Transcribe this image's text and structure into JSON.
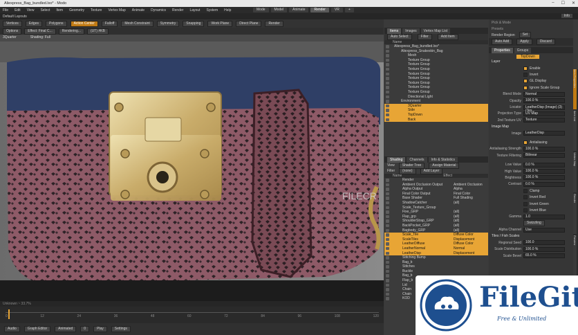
{
  "app": {
    "title": "Aliexpress_Bag_bundled.lxo* - Modo",
    "win_buttons": [
      "–",
      "☐",
      "✕"
    ]
  },
  "menu": [
    "File",
    "Edit",
    "View",
    "Select",
    "Item",
    "Geometry",
    "Texture",
    "Vertex Map",
    "Animate",
    "Dynamics",
    "Render",
    "Layout",
    "System",
    "Help"
  ],
  "modes": [
    {
      "label": "Mode",
      "on": false
    },
    {
      "label": "Model",
      "on": false
    },
    {
      "label": "Animate",
      "on": false
    },
    {
      "label": "Render",
      "on": true
    },
    {
      "label": "VR",
      "on": false
    },
    {
      "label": "+",
      "on": false
    }
  ],
  "layout_label": "Default Layouts",
  "info_label": "Info",
  "toolbar": [
    "Vertices",
    "Edges",
    "Polygons",
    "Action Center",
    "Falloff",
    "Mesh Constraint",
    "Symmetry",
    "Snapping",
    "Work Plane",
    "Direct Plane",
    "Render"
  ],
  "viewport_header": [
    "Options",
    "Effect: Final C...",
    "Rendering...",
    "(UT) #KB"
  ],
  "viewport_sub": [
    "3Quarter",
    "Shading: Full"
  ],
  "viewport_status": "Unknown  ~  33.7%",
  "transport": [
    "Audio",
    "Graph Editor",
    "Animated",
    "0",
    "Play",
    "Settings"
  ],
  "timeline_ticks": [
    "0",
    "12",
    "24",
    "36",
    "48",
    "60",
    "72",
    "84",
    "96",
    "108",
    "120"
  ],
  "watermark": "FILECR",
  "right_tabs1": [
    "Items",
    "Images",
    "Vertex Map List"
  ],
  "right_tabs1_extra": [
    "Auto Select",
    "Filter",
    "Add Item"
  ],
  "items_header": "Name",
  "items": [
    {
      "label": "Aliexpress_Bag_bundled.lxo*",
      "indent": 0,
      "sel": false
    },
    {
      "label": "Aliexpress_Snakeskin_Bag",
      "indent": 1,
      "sel": false
    },
    {
      "label": "Mesh",
      "indent": 2,
      "sel": false
    },
    {
      "label": "Texture Group",
      "indent": 2,
      "sel": false
    },
    {
      "label": "Texture Group",
      "indent": 2,
      "sel": false
    },
    {
      "label": "Texture Group",
      "indent": 2,
      "sel": false
    },
    {
      "label": "Texture Group",
      "indent": 2,
      "sel": false
    },
    {
      "label": "Texture Group",
      "indent": 2,
      "sel": false
    },
    {
      "label": "Texture Group",
      "indent": 2,
      "sel": false
    },
    {
      "label": "Texture Group",
      "indent": 2,
      "sel": false
    },
    {
      "label": "Texture Group",
      "indent": 2,
      "sel": false
    },
    {
      "label": "Directional Light",
      "indent": 2,
      "sel": false
    },
    {
      "label": "Environment",
      "indent": 1,
      "sel": false
    },
    {
      "label": "3Quarter",
      "indent": 2,
      "sel": true
    },
    {
      "label": "Side",
      "indent": 2,
      "sel": true
    },
    {
      "label": "TopDown",
      "indent": 2,
      "sel": true
    },
    {
      "label": "Back",
      "indent": 2,
      "sel": true
    }
  ],
  "right_tabs2": [
    "Shading",
    "Channels",
    "Info & Statistics"
  ],
  "shader_view": [
    "View",
    "Shader Tree",
    "Assign Material"
  ],
  "shader_filter": [
    "Filter",
    "(none)",
    "Add Layer"
  ],
  "shader_header": [
    "Name",
    "Effect"
  ],
  "shader": [
    {
      "name": "Render",
      "effect": "",
      "sel": false
    },
    {
      "name": "Ambient Occlusion Output",
      "effect": "Ambient Occlusion",
      "sel": false
    },
    {
      "name": "Alpha Output",
      "effect": "Alpha",
      "sel": false
    },
    {
      "name": "Final Color Output",
      "effect": "Final Color",
      "sel": false
    },
    {
      "name": "Base Shader",
      "effect": "Full Shading",
      "sel": false
    },
    {
      "name": "ShadowCatcher",
      "effect": "(all)",
      "sel": false
    },
    {
      "name": "Scale_Texture_Group",
      "effect": "",
      "sel": false
    },
    {
      "name": "Fixe_GRP",
      "effect": "(all)",
      "sel": false
    },
    {
      "name": "Flap_grp",
      "effect": "(all)",
      "sel": false
    },
    {
      "name": "ShoulderStrap_GRP",
      "effect": "(all)",
      "sel": false
    },
    {
      "name": "BackPocket_GRP",
      "effect": "(all)",
      "sel": false
    },
    {
      "name": "Bagbody_GRP",
      "effect": "(all)",
      "sel": false
    },
    {
      "name": "Scale_Tile",
      "effect": "Diffuse Color",
      "sel": true
    },
    {
      "name": "ScaleTiles",
      "effect": "Displacement",
      "sel": true
    },
    {
      "name": "LeatherDiffuse",
      "effect": "Diffuse Color",
      "sel": true
    },
    {
      "name": "LeatherNormal",
      "effect": "Normal",
      "sel": true
    },
    {
      "name": "LeatherDisp",
      "effect": "Displacement",
      "sel": true
    },
    {
      "name": "Stitching Bump",
      "effect": "",
      "sel": false
    },
    {
      "name": "Bag_b",
      "effect": "",
      "sel": false
    },
    {
      "name": "Stitches",
      "effect": "",
      "sel": false
    },
    {
      "name": "Buckle",
      "effect": "",
      "sel": false
    },
    {
      "name": "Bag_b",
      "effect": "",
      "sel": false
    },
    {
      "name": "Flap_b",
      "effect": "",
      "sel": false
    },
    {
      "name": "Lid",
      "effect": "",
      "sel": false
    },
    {
      "name": "Chain",
      "effect": "",
      "sel": false
    },
    {
      "name": "Chain",
      "effect": "",
      "sel": false
    },
    {
      "name": "KOD",
      "effect": "",
      "sel": false
    }
  ],
  "props_top": {
    "label1": "Pick & Mode",
    "label2": "Presets",
    "label3": "Render Region",
    "auto_add": "Auto Add",
    "apply": "Apply",
    "discard": "Discard",
    "set": "Set"
  },
  "props_tabs": [
    "Properties",
    "Groups"
  ],
  "props_item": "TopDown",
  "props_section": "Layer",
  "props": [
    {
      "label": "",
      "value": "Enable",
      "type": "chk"
    },
    {
      "label": "",
      "value": "Invert",
      "type": "chkoff"
    },
    {
      "label": "",
      "value": "GL Display",
      "type": "chk"
    },
    {
      "label": "",
      "value": "Ignore Scale Group",
      "type": "chk"
    },
    {
      "label": "Blend Mode",
      "value": "Normal",
      "type": "val"
    },
    {
      "label": "Opacity",
      "value": "100.0 %",
      "type": "val"
    },
    {
      "label": "Locator",
      "value": "LeatherDisp (Image) (3) (Tex...",
      "type": "val"
    },
    {
      "label": "Projection Type",
      "value": "UV Map",
      "type": "val"
    },
    {
      "label": "2nd Texture UV",
      "value": "Texture",
      "type": "val"
    },
    {
      "label": "Image Map",
      "value": "",
      "type": "section"
    },
    {
      "label": "Image",
      "value": "LeatherDisp",
      "type": "val"
    },
    {
      "label": "",
      "value": "",
      "type": "gap"
    },
    {
      "label": "",
      "value": "Antialiasing",
      "type": "chk"
    },
    {
      "label": "Antialiasing Strength",
      "value": "100.0 %",
      "type": "val"
    },
    {
      "label": "Texture Filtering",
      "value": "Bilinear",
      "type": "val"
    },
    {
      "label": "",
      "value": "",
      "type": "gap"
    },
    {
      "label": "Low Value",
      "value": "0.0 %",
      "type": "val"
    },
    {
      "label": "High Value",
      "value": "100.0 %",
      "type": "val"
    },
    {
      "label": "Brightness",
      "value": "100.0 %",
      "type": "val"
    },
    {
      "label": "Contrast",
      "value": "0.0 %",
      "type": "val"
    },
    {
      "label": "",
      "value": "Clamp",
      "type": "chkoff"
    },
    {
      "label": "",
      "value": "Invert Red",
      "type": "chkoff"
    },
    {
      "label": "",
      "value": "Invert Green",
      "type": "chkoff"
    },
    {
      "label": "",
      "value": "Invert Blue",
      "type": "chkoff"
    },
    {
      "label": "Gamma",
      "value": "1.0",
      "type": "val"
    },
    {
      "label": "",
      "value": "Swizzling",
      "type": "btn"
    },
    {
      "label": "Alpha Channel",
      "value": "Use",
      "type": "val"
    },
    {
      "label": "Tiles / Fish Scales",
      "value": "",
      "type": "section"
    },
    {
      "label": "Regional Seed",
      "value": "100.0",
      "type": "val"
    },
    {
      "label": "Scale Distribution",
      "value": "100.0 %",
      "type": "val"
    },
    {
      "label": "Scale Bevel",
      "value": "65.0 %",
      "type": "val"
    }
  ],
  "side_tabs": [
    "Item Properties",
    "Item List",
    "Vertex Map",
    "Render",
    "Preview"
  ],
  "filegit": {
    "title": "FileGit",
    "subtitle": "Free & Unlimited"
  },
  "colors": {
    "accent": "#e8a535",
    "panel": "#3b3b3b",
    "dark": "#2b2b2b",
    "filegit_blue": "#1e4f8f"
  }
}
